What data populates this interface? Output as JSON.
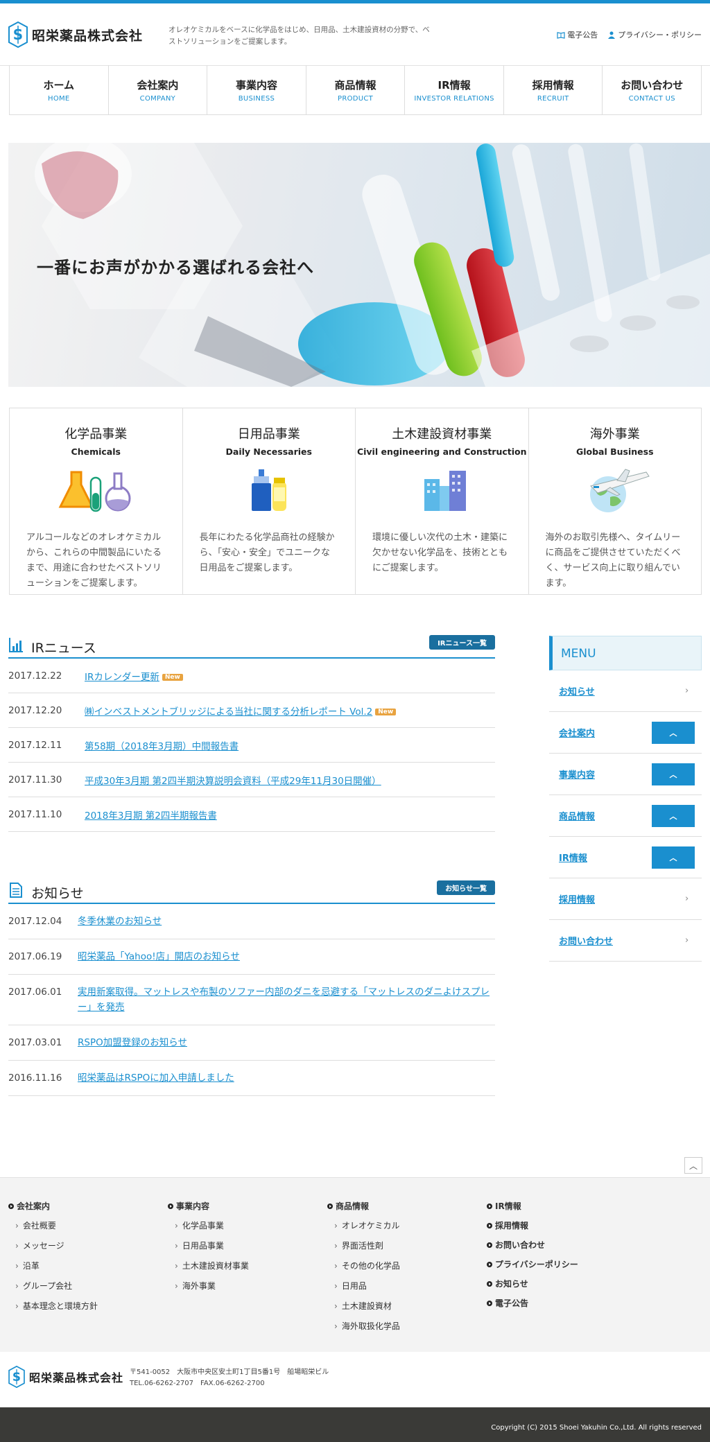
{
  "header": {
    "company_name": "昭栄薬品株式会社",
    "tagline": "オレオケミカルをベースに化学品をはじめ、日用品、土木建設資材の分野で、ベストソリューションをご提案します。",
    "links": [
      {
        "label": "電子公告",
        "icon": "book-icon"
      },
      {
        "label": "プライバシー・ポリシー",
        "icon": "person-icon"
      }
    ]
  },
  "nav": [
    {
      "jp": "ホーム",
      "en": "HOME"
    },
    {
      "jp": "会社案内",
      "en": "COMPANY"
    },
    {
      "jp": "事業内容",
      "en": "BUSINESS"
    },
    {
      "jp": "商品情報",
      "en": "PRODUCT"
    },
    {
      "jp": "IR情報",
      "en": "INVESTOR RELATIONS"
    },
    {
      "jp": "採用情報",
      "en": "RECRUIT"
    },
    {
      "jp": "お問い合わせ",
      "en": "CONTACT US"
    }
  ],
  "hero": {
    "headline": "一番にお声がかかる選ばれる会社へ"
  },
  "cards": [
    {
      "jp": "化学品事業",
      "en": "Chemicals",
      "icon": "flask-icon",
      "desc": "アルコールなどのオレオケミカルから、これらの中間製品にいたるまで、用途に合わせたベストソリューションをご提案します。"
    },
    {
      "jp": "日用品事業",
      "en": "Daily Necessaries",
      "icon": "bottles-icon",
      "desc": "長年にわたる化学品商社の経験から、「安心・安全」でユニークな日用品をご提案します。"
    },
    {
      "jp": "土木建設資材事業",
      "en": "Civil engineering and Construction",
      "icon": "buildings-icon",
      "desc": "環境に優しい次代の土木・建築に欠かせない化学品を、技術とともにご提案します。"
    },
    {
      "jp": "海外事業",
      "en": "Global Business",
      "icon": "airplane-globe-icon",
      "desc": "海外のお取引先様へ、タイムリーに商品をご提供させていただくべく、サービス向上に取り組んでいます。"
    }
  ],
  "ir_news": {
    "title": "IRニュース",
    "button": "IRニュース一覧",
    "new_label": "New",
    "items": [
      {
        "date": "2017.12.22",
        "text": "IRカレンダー更新",
        "new": true
      },
      {
        "date": "2017.12.20",
        "text": "㈱インベストメントブリッジによる当社に関する分析レポート Vol.2",
        "new": true
      },
      {
        "date": "2017.12.11",
        "text": "第58期（2018年3月期）中間報告書",
        "new": false
      },
      {
        "date": "2017.11.30",
        "text": "平成30年3月期 第2四半期決算説明会資料（平成29年11月30日開催）",
        "new": false
      },
      {
        "date": "2017.11.10",
        "text": "2018年3月期 第2四半期報告書",
        "new": false
      }
    ]
  },
  "notices": {
    "title": "お知らせ",
    "button": "お知らせ一覧",
    "items": [
      {
        "date": "2017.12.04",
        "text": "冬季休業のお知らせ"
      },
      {
        "date": "2017.06.19",
        "text": "昭栄薬品「Yahoo!店」開店のお知らせ"
      },
      {
        "date": "2017.06.01",
        "text": "実用新案取得。マットレスや布製のソファー内部のダニを忌避する「マットレスのダニよけスプレー」を発売"
      },
      {
        "date": "2017.03.01",
        "text": "RSPO加盟登録のお知らせ"
      },
      {
        "date": "2016.11.16",
        "text": "昭栄薬品はRSPOに加入申請しました"
      }
    ]
  },
  "sidebar": {
    "title": "MENU",
    "items": [
      {
        "label": "お知らせ",
        "type": "link"
      },
      {
        "label": "会社案内",
        "type": "expand"
      },
      {
        "label": "事業内容",
        "type": "expand"
      },
      {
        "label": "商品情報",
        "type": "expand"
      },
      {
        "label": "IR情報",
        "type": "expand"
      },
      {
        "label": "採用情報",
        "type": "link"
      },
      {
        "label": "お問い合わせ",
        "type": "link"
      }
    ]
  },
  "footer_nav": [
    {
      "head": "会社案内",
      "items": [
        "会社概要",
        "メッセージ",
        "沿革",
        "グループ会社",
        "基本理念と環境方針"
      ]
    },
    {
      "head": "事業内容",
      "items": [
        "化学品事業",
        "日用品事業",
        "土木建設資材事業",
        "海外事業"
      ]
    },
    {
      "head": "商品情報",
      "items": [
        "オレオケミカル",
        "界面活性剤",
        "その他の化学品",
        "日用品",
        "土木建設資材",
        "海外取扱化学品"
      ]
    },
    {
      "heads": [
        "IR情報",
        "採用情報",
        "お問い合わせ",
        "プライバシーポリシー",
        "お知らせ",
        "電子公告"
      ]
    }
  ],
  "footer": {
    "address": "〒541-0052　大阪市中央区安土町1丁目5番1号　船場昭栄ビル",
    "tel": "TEL.06-6262-2707　FAX.06-6262-2700",
    "copyright": "Copyright (C) 2015 Shoei Yakuhin Co.,Ltd. All rights reserved"
  },
  "colors": {
    "accent": "#1a8fcf",
    "dark_button": "#1a6f9f",
    "footer_bg": "#3a3a37"
  }
}
